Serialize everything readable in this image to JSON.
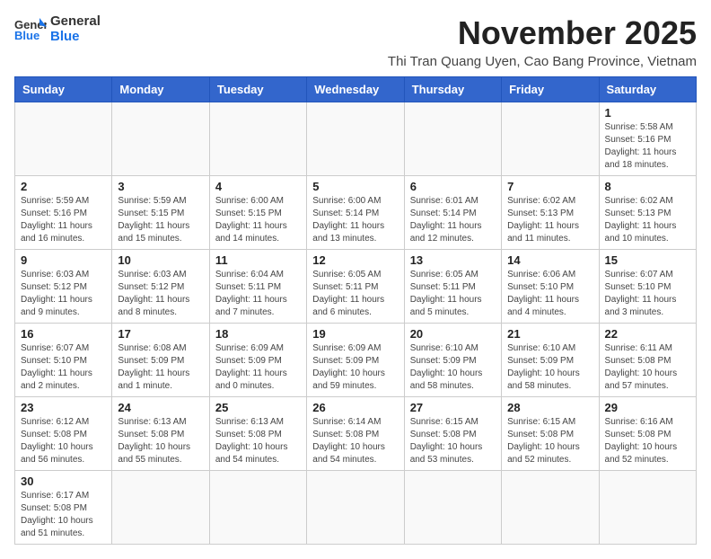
{
  "header": {
    "logo_general": "General",
    "logo_blue": "Blue",
    "month_title": "November 2025",
    "subtitle": "Thi Tran Quang Uyen, Cao Bang Province, Vietnam"
  },
  "days_of_week": [
    "Sunday",
    "Monday",
    "Tuesday",
    "Wednesday",
    "Thursday",
    "Friday",
    "Saturday"
  ],
  "weeks": [
    [
      {
        "day": "",
        "info": ""
      },
      {
        "day": "",
        "info": ""
      },
      {
        "day": "",
        "info": ""
      },
      {
        "day": "",
        "info": ""
      },
      {
        "day": "",
        "info": ""
      },
      {
        "day": "",
        "info": ""
      },
      {
        "day": "1",
        "info": "Sunrise: 5:58 AM\nSunset: 5:16 PM\nDaylight: 11 hours and 18 minutes."
      }
    ],
    [
      {
        "day": "2",
        "info": "Sunrise: 5:59 AM\nSunset: 5:16 PM\nDaylight: 11 hours and 16 minutes."
      },
      {
        "day": "3",
        "info": "Sunrise: 5:59 AM\nSunset: 5:15 PM\nDaylight: 11 hours and 15 minutes."
      },
      {
        "day": "4",
        "info": "Sunrise: 6:00 AM\nSunset: 5:15 PM\nDaylight: 11 hours and 14 minutes."
      },
      {
        "day": "5",
        "info": "Sunrise: 6:00 AM\nSunset: 5:14 PM\nDaylight: 11 hours and 13 minutes."
      },
      {
        "day": "6",
        "info": "Sunrise: 6:01 AM\nSunset: 5:14 PM\nDaylight: 11 hours and 12 minutes."
      },
      {
        "day": "7",
        "info": "Sunrise: 6:02 AM\nSunset: 5:13 PM\nDaylight: 11 hours and 11 minutes."
      },
      {
        "day": "8",
        "info": "Sunrise: 6:02 AM\nSunset: 5:13 PM\nDaylight: 11 hours and 10 minutes."
      }
    ],
    [
      {
        "day": "9",
        "info": "Sunrise: 6:03 AM\nSunset: 5:12 PM\nDaylight: 11 hours and 9 minutes."
      },
      {
        "day": "10",
        "info": "Sunrise: 6:03 AM\nSunset: 5:12 PM\nDaylight: 11 hours and 8 minutes."
      },
      {
        "day": "11",
        "info": "Sunrise: 6:04 AM\nSunset: 5:11 PM\nDaylight: 11 hours and 7 minutes."
      },
      {
        "day": "12",
        "info": "Sunrise: 6:05 AM\nSunset: 5:11 PM\nDaylight: 11 hours and 6 minutes."
      },
      {
        "day": "13",
        "info": "Sunrise: 6:05 AM\nSunset: 5:11 PM\nDaylight: 11 hours and 5 minutes."
      },
      {
        "day": "14",
        "info": "Sunrise: 6:06 AM\nSunset: 5:10 PM\nDaylight: 11 hours and 4 minutes."
      },
      {
        "day": "15",
        "info": "Sunrise: 6:07 AM\nSunset: 5:10 PM\nDaylight: 11 hours and 3 minutes."
      }
    ],
    [
      {
        "day": "16",
        "info": "Sunrise: 6:07 AM\nSunset: 5:10 PM\nDaylight: 11 hours and 2 minutes."
      },
      {
        "day": "17",
        "info": "Sunrise: 6:08 AM\nSunset: 5:09 PM\nDaylight: 11 hours and 1 minute."
      },
      {
        "day": "18",
        "info": "Sunrise: 6:09 AM\nSunset: 5:09 PM\nDaylight: 11 hours and 0 minutes."
      },
      {
        "day": "19",
        "info": "Sunrise: 6:09 AM\nSunset: 5:09 PM\nDaylight: 10 hours and 59 minutes."
      },
      {
        "day": "20",
        "info": "Sunrise: 6:10 AM\nSunset: 5:09 PM\nDaylight: 10 hours and 58 minutes."
      },
      {
        "day": "21",
        "info": "Sunrise: 6:10 AM\nSunset: 5:09 PM\nDaylight: 10 hours and 58 minutes."
      },
      {
        "day": "22",
        "info": "Sunrise: 6:11 AM\nSunset: 5:08 PM\nDaylight: 10 hours and 57 minutes."
      }
    ],
    [
      {
        "day": "23",
        "info": "Sunrise: 6:12 AM\nSunset: 5:08 PM\nDaylight: 10 hours and 56 minutes."
      },
      {
        "day": "24",
        "info": "Sunrise: 6:13 AM\nSunset: 5:08 PM\nDaylight: 10 hours and 55 minutes."
      },
      {
        "day": "25",
        "info": "Sunrise: 6:13 AM\nSunset: 5:08 PM\nDaylight: 10 hours and 54 minutes."
      },
      {
        "day": "26",
        "info": "Sunrise: 6:14 AM\nSunset: 5:08 PM\nDaylight: 10 hours and 54 minutes."
      },
      {
        "day": "27",
        "info": "Sunrise: 6:15 AM\nSunset: 5:08 PM\nDaylight: 10 hours and 53 minutes."
      },
      {
        "day": "28",
        "info": "Sunrise: 6:15 AM\nSunset: 5:08 PM\nDaylight: 10 hours and 52 minutes."
      },
      {
        "day": "29",
        "info": "Sunrise: 6:16 AM\nSunset: 5:08 PM\nDaylight: 10 hours and 52 minutes."
      }
    ],
    [
      {
        "day": "30",
        "info": "Sunrise: 6:17 AM\nSunset: 5:08 PM\nDaylight: 10 hours and 51 minutes."
      },
      {
        "day": "",
        "info": ""
      },
      {
        "day": "",
        "info": ""
      },
      {
        "day": "",
        "info": ""
      },
      {
        "day": "",
        "info": ""
      },
      {
        "day": "",
        "info": ""
      },
      {
        "day": "",
        "info": ""
      }
    ]
  ]
}
